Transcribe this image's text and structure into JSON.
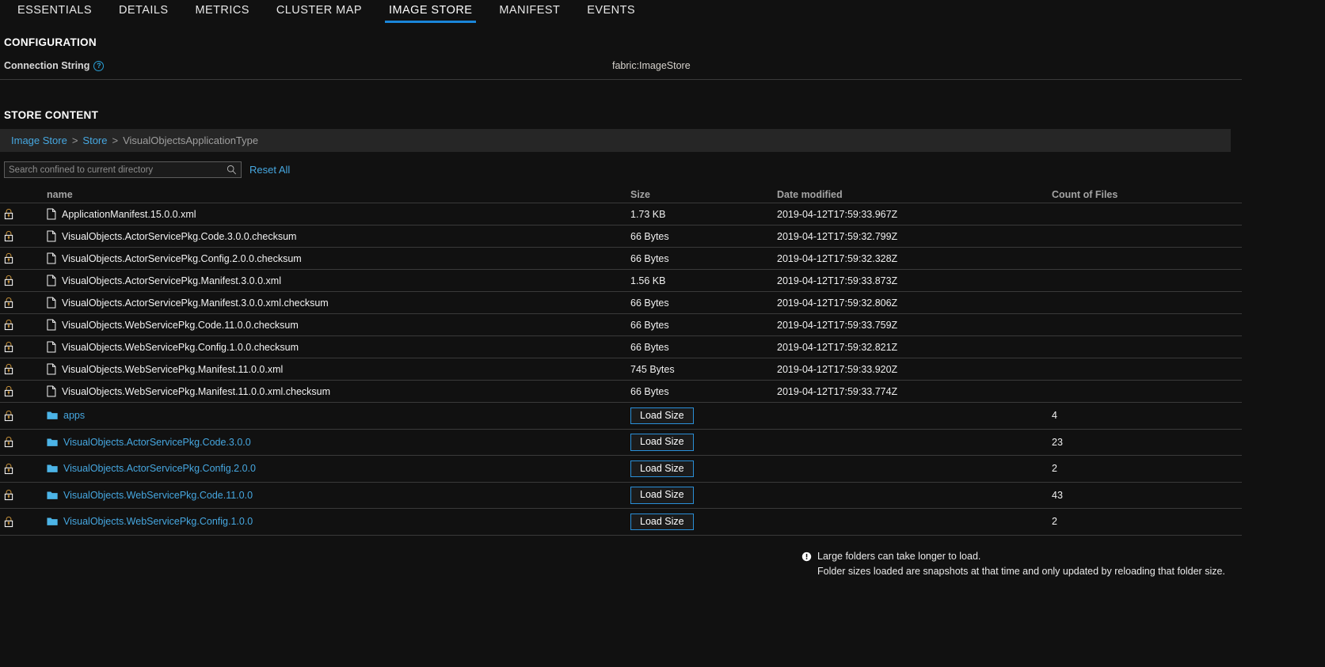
{
  "tabs": [
    {
      "label": "ESSENTIALS",
      "active": false
    },
    {
      "label": "DETAILS",
      "active": false
    },
    {
      "label": "METRICS",
      "active": false
    },
    {
      "label": "CLUSTER MAP",
      "active": false
    },
    {
      "label": "IMAGE STORE",
      "active": true
    },
    {
      "label": "MANIFEST",
      "active": false
    },
    {
      "label": "EVENTS",
      "active": false
    }
  ],
  "configuration": {
    "title": "CONFIGURATION",
    "connection_string_label": "Connection String",
    "help_icon": "question-mark-icon",
    "connection_string_value": "fabric:ImageStore"
  },
  "store_content": {
    "title": "STORE CONTENT",
    "breadcrumb": {
      "items": [
        {
          "label": "Image Store",
          "link": true
        },
        {
          "label": "Store",
          "link": true
        },
        {
          "label": "VisualObjectsApplicationType",
          "link": false
        }
      ],
      "separator": ">"
    },
    "search": {
      "placeholder": "Search confined to current directory",
      "value": "",
      "icon": "search-icon"
    },
    "reset_all_label": "Reset All",
    "columns": {
      "lock": "",
      "name": "name",
      "size": "Size",
      "date_modified": "Date modified",
      "count_of_files": "Count of Files"
    },
    "load_size_label": "Load Size",
    "rows": [
      {
        "type": "file",
        "locked": true,
        "name": "ApplicationManifest.15.0.0.xml",
        "size": "1.73 KB",
        "date": "2019-04-12T17:59:33.967Z",
        "count": ""
      },
      {
        "type": "file",
        "locked": true,
        "name": "VisualObjects.ActorServicePkg.Code.3.0.0.checksum",
        "size": "66 Bytes",
        "date": "2019-04-12T17:59:32.799Z",
        "count": ""
      },
      {
        "type": "file",
        "locked": true,
        "name": "VisualObjects.ActorServicePkg.Config.2.0.0.checksum",
        "size": "66 Bytes",
        "date": "2019-04-12T17:59:32.328Z",
        "count": ""
      },
      {
        "type": "file",
        "locked": true,
        "name": "VisualObjects.ActorServicePkg.Manifest.3.0.0.xml",
        "size": "1.56 KB",
        "date": "2019-04-12T17:59:33.873Z",
        "count": ""
      },
      {
        "type": "file",
        "locked": true,
        "name": "VisualObjects.ActorServicePkg.Manifest.3.0.0.xml.checksum",
        "size": "66 Bytes",
        "date": "2019-04-12T17:59:32.806Z",
        "count": ""
      },
      {
        "type": "file",
        "locked": true,
        "name": "VisualObjects.WebServicePkg.Code.11.0.0.checksum",
        "size": "66 Bytes",
        "date": "2019-04-12T17:59:33.759Z",
        "count": ""
      },
      {
        "type": "file",
        "locked": true,
        "name": "VisualObjects.WebServicePkg.Config.1.0.0.checksum",
        "size": "66 Bytes",
        "date": "2019-04-12T17:59:32.821Z",
        "count": ""
      },
      {
        "type": "file",
        "locked": true,
        "name": "VisualObjects.WebServicePkg.Manifest.11.0.0.xml",
        "size": "745 Bytes",
        "date": "2019-04-12T17:59:33.920Z",
        "count": ""
      },
      {
        "type": "file",
        "locked": true,
        "name": "VisualObjects.WebServicePkg.Manifest.11.0.0.xml.checksum",
        "size": "66 Bytes",
        "date": "2019-04-12T17:59:33.774Z",
        "count": ""
      },
      {
        "type": "folder",
        "locked": true,
        "name": "apps",
        "size": "Load Size",
        "date": "",
        "count": "4"
      },
      {
        "type": "folder",
        "locked": true,
        "name": "VisualObjects.ActorServicePkg.Code.3.0.0",
        "size": "Load Size",
        "date": "",
        "count": "23"
      },
      {
        "type": "folder",
        "locked": true,
        "name": "VisualObjects.ActorServicePkg.Config.2.0.0",
        "size": "Load Size",
        "date": "",
        "count": "2"
      },
      {
        "type": "folder",
        "locked": true,
        "name": "VisualObjects.WebServicePkg.Code.11.0.0",
        "size": "Load Size",
        "date": "",
        "count": "43"
      },
      {
        "type": "folder",
        "locked": true,
        "name": "VisualObjects.WebServicePkg.Config.1.0.0",
        "size": "Load Size",
        "date": "",
        "count": "2"
      }
    ]
  },
  "notes": {
    "icon": "info-icon",
    "line1": "Large folders can take longer to load.",
    "line2": "Folder sizes loaded are snapshots at that time and only updated by reloading that folder size."
  },
  "colors": {
    "background": "#111111",
    "accent_blue": "#1a86d9",
    "link_blue": "#46a7e0",
    "row_divider": "#3a3a3a",
    "breadcrumb_bar": "#262626",
    "lock_gold": "#c8933c"
  }
}
